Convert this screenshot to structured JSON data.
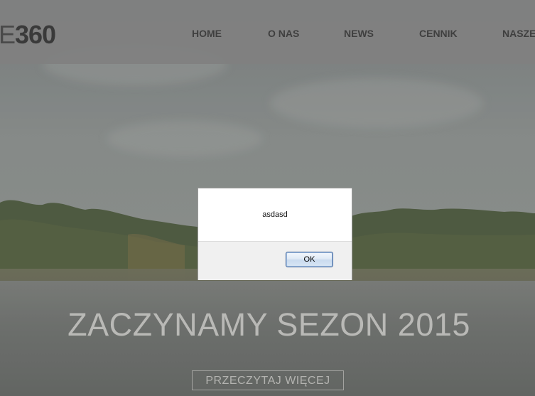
{
  "header": {
    "logo_left": "E",
    "logo_right": "360",
    "nav": [
      "HOME",
      "O NAS",
      "NEWS",
      "CENNIK",
      "NASZE"
    ]
  },
  "hero": {
    "headline": "ZACZYNAMY SEZON 2015",
    "read_more_label": "PRZECZYTAJ WIĘCEJ"
  },
  "alert": {
    "message": "asdasd",
    "ok_label": "OK"
  },
  "colors": {
    "navbar": "#808080",
    "nav_text": "#3f3f3f",
    "headline": "#b9b9b6",
    "dialog_bg": "#ffffff",
    "dialog_footer": "#f0f0f0"
  }
}
